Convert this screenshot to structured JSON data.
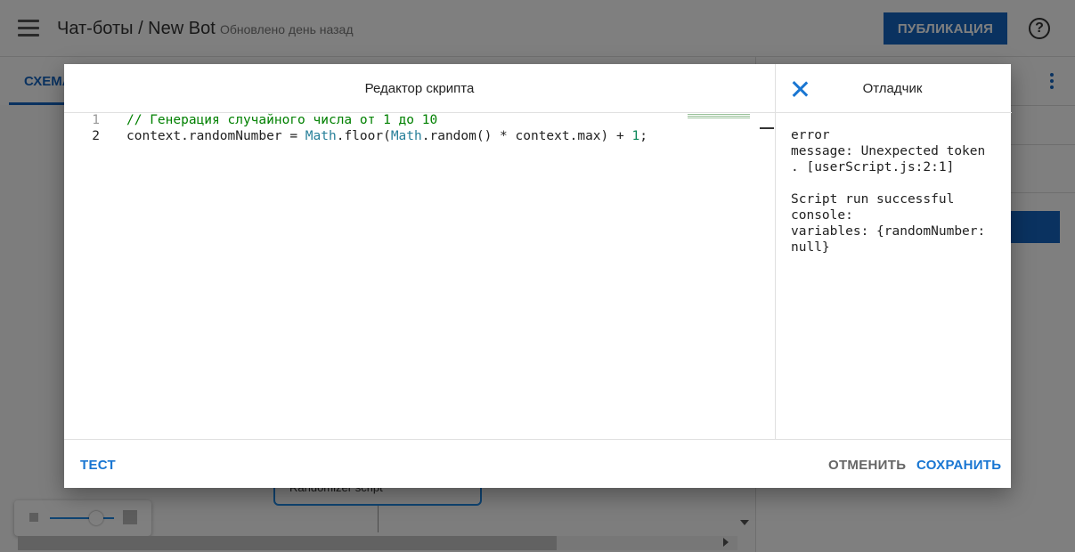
{
  "app": {
    "title": "Чат-боты / New Bot",
    "subtitle": "Обновлено день назад",
    "publish_label": "ПУБЛИКАЦИЯ",
    "help_glyph": "?"
  },
  "tabs": {
    "schema_label": "СХЕМА"
  },
  "canvas": {
    "node_label": "Randomizer script"
  },
  "dialog": {
    "editor_title": "Редактор скрипта",
    "code_lines": [
      {
        "number": "1",
        "tokens": [
          {
            "t": "// Генерация случайного числа от 1 до 10",
            "c": "comment"
          }
        ]
      },
      {
        "number": "2",
        "tokens": [
          {
            "t": "context.randomNumber = ",
            "c": ""
          },
          {
            "t": "Math",
            "c": "builtin"
          },
          {
            "t": ".floor(",
            "c": ""
          },
          {
            "t": "Math",
            "c": "builtin"
          },
          {
            "t": ".random() * context.max) + ",
            "c": ""
          },
          {
            "t": "1",
            "c": "num"
          },
          {
            "t": ";",
            "c": ""
          }
        ]
      }
    ],
    "debugger_title": "Отладчик",
    "debugger_output": "error\nmessage: Unexpected token\n. [userScript.js:2:1]\n\nScript run successful\nconsole:\nvariables: {randomNumber:\nnull}",
    "test_label": "ТЕСТ",
    "cancel_label": "ОТМЕНИТЬ",
    "save_label": "СОХРАНИТЬ"
  },
  "colors": {
    "accent": "#1976d2",
    "publish": "#1565c0",
    "comment": "#008000",
    "builtin": "#267f99",
    "number": "#098658"
  },
  "icons": {
    "menu": "menu-icon",
    "help": "help-icon",
    "close": "close-icon",
    "more": "more-vert-icon"
  }
}
